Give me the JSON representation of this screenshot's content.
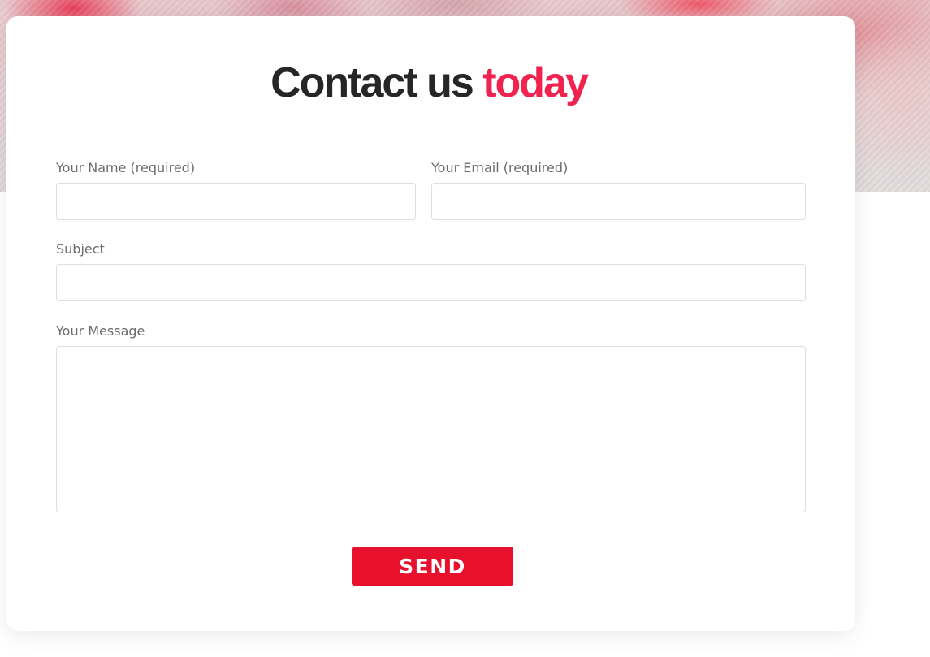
{
  "heading": {
    "main": "Contact us",
    "accent": "today",
    "accent_color": "#f0224f"
  },
  "form": {
    "name": {
      "label": "Your Name (required)",
      "value": ""
    },
    "email": {
      "label": "Your Email (required)",
      "value": ""
    },
    "subject": {
      "label": "Subject",
      "value": ""
    },
    "message": {
      "label": "Your Message",
      "value": ""
    },
    "send_label": "SEND",
    "send_color": "#e8112d"
  }
}
